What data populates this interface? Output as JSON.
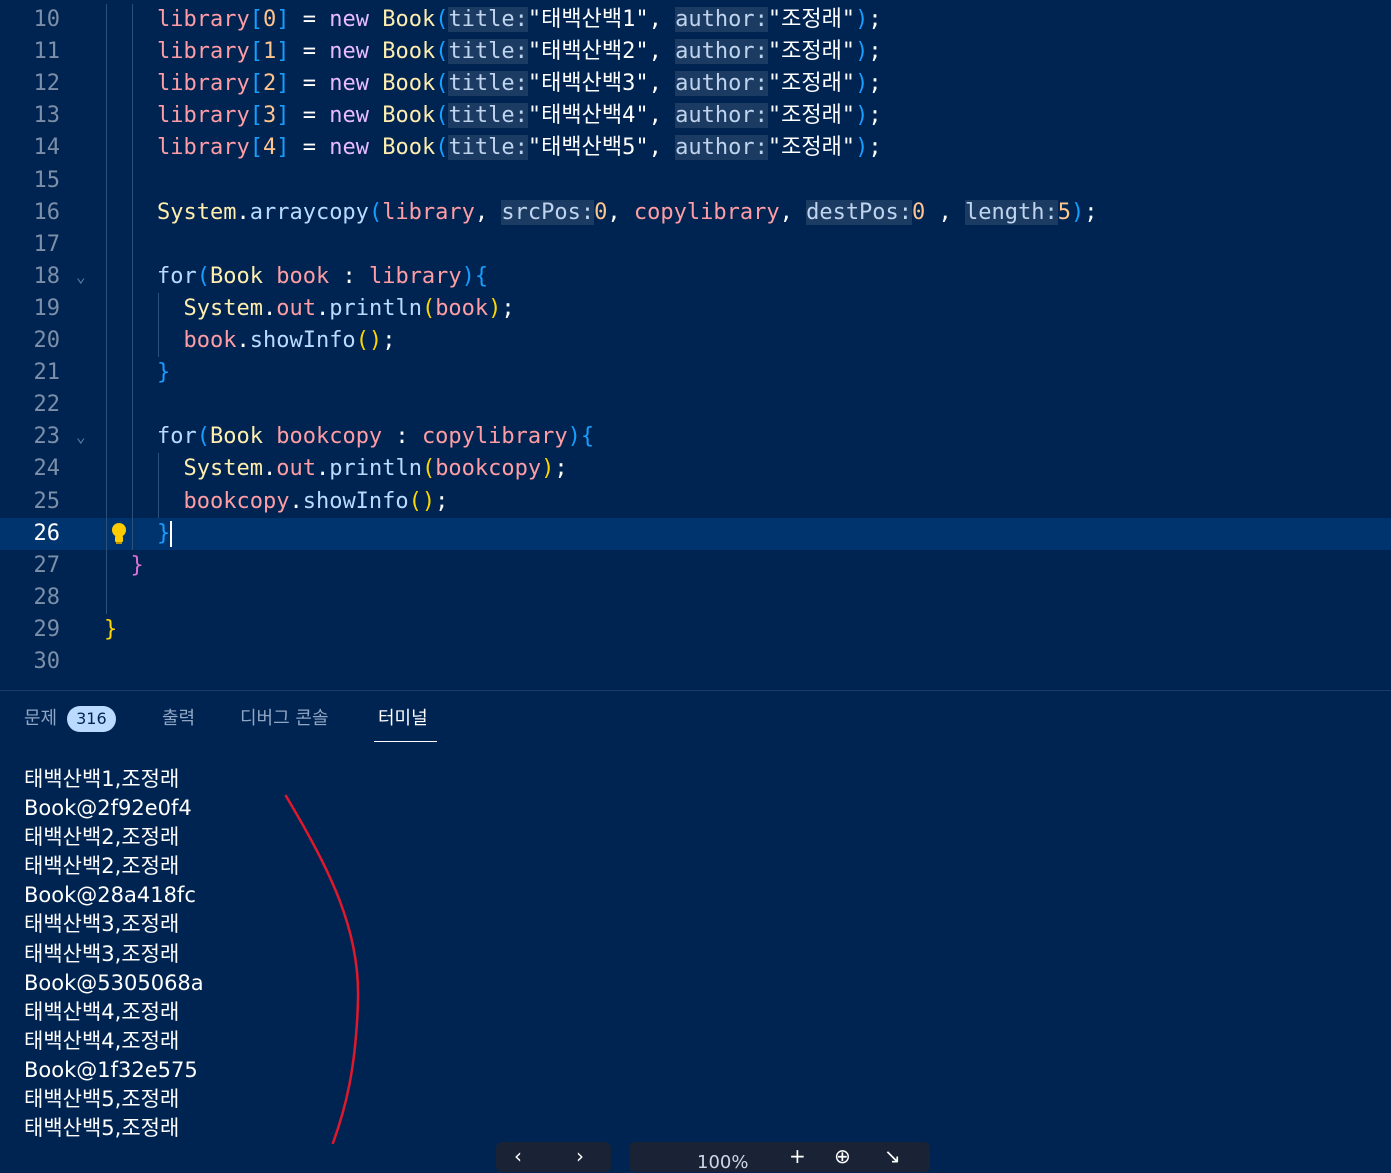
{
  "editor": {
    "lines": [
      {
        "n": "10",
        "fold": "",
        "tokens": [
          [
            "library",
            "var"
          ],
          [
            "[",
            "b3"
          ],
          [
            "0",
            "num"
          ],
          [
            "]",
            "b3"
          ],
          [
            " = ",
            "op"
          ],
          [
            "new",
            "kw"
          ],
          [
            " ",
            "op"
          ],
          [
            "Book",
            "cls"
          ],
          [
            "(",
            "b3"
          ],
          [
            "title:",
            "hint"
          ],
          [
            "\"태백산백1\"",
            "str"
          ],
          [
            ", ",
            "op"
          ],
          [
            "author:",
            "hint"
          ],
          [
            "\"조정래\"",
            "str"
          ],
          [
            ")",
            "b3"
          ],
          [
            ";",
            "op"
          ]
        ]
      },
      {
        "n": "11",
        "fold": "",
        "tokens": [
          [
            "library",
            "var"
          ],
          [
            "[",
            "b3"
          ],
          [
            "1",
            "num"
          ],
          [
            "]",
            "b3"
          ],
          [
            " = ",
            "op"
          ],
          [
            "new",
            "kw"
          ],
          [
            " ",
            "op"
          ],
          [
            "Book",
            "cls"
          ],
          [
            "(",
            "b3"
          ],
          [
            "title:",
            "hint"
          ],
          [
            "\"태백산백2\"",
            "str"
          ],
          [
            ", ",
            "op"
          ],
          [
            "author:",
            "hint"
          ],
          [
            "\"조정래\"",
            "str"
          ],
          [
            ")",
            "b3"
          ],
          [
            ";",
            "op"
          ]
        ]
      },
      {
        "n": "12",
        "fold": "",
        "tokens": [
          [
            "library",
            "var"
          ],
          [
            "[",
            "b3"
          ],
          [
            "2",
            "num"
          ],
          [
            "]",
            "b3"
          ],
          [
            " = ",
            "op"
          ],
          [
            "new",
            "kw"
          ],
          [
            " ",
            "op"
          ],
          [
            "Book",
            "cls"
          ],
          [
            "(",
            "b3"
          ],
          [
            "title:",
            "hint"
          ],
          [
            "\"태백산백3\"",
            "str"
          ],
          [
            ", ",
            "op"
          ],
          [
            "author:",
            "hint"
          ],
          [
            "\"조정래\"",
            "str"
          ],
          [
            ")",
            "b3"
          ],
          [
            ";",
            "op"
          ]
        ]
      },
      {
        "n": "13",
        "fold": "",
        "tokens": [
          [
            "library",
            "var"
          ],
          [
            "[",
            "b3"
          ],
          [
            "3",
            "num"
          ],
          [
            "]",
            "b3"
          ],
          [
            " = ",
            "op"
          ],
          [
            "new",
            "kw"
          ],
          [
            " ",
            "op"
          ],
          [
            "Book",
            "cls"
          ],
          [
            "(",
            "b3"
          ],
          [
            "title:",
            "hint"
          ],
          [
            "\"태백산백4\"",
            "str"
          ],
          [
            ", ",
            "op"
          ],
          [
            "author:",
            "hint"
          ],
          [
            "\"조정래\"",
            "str"
          ],
          [
            ")",
            "b3"
          ],
          [
            ";",
            "op"
          ]
        ]
      },
      {
        "n": "14",
        "fold": "",
        "tokens": [
          [
            "library",
            "var"
          ],
          [
            "[",
            "b3"
          ],
          [
            "4",
            "num"
          ],
          [
            "]",
            "b3"
          ],
          [
            " = ",
            "op"
          ],
          [
            "new",
            "kw"
          ],
          [
            " ",
            "op"
          ],
          [
            "Book",
            "cls"
          ],
          [
            "(",
            "b3"
          ],
          [
            "title:",
            "hint"
          ],
          [
            "\"태백산백5\"",
            "str"
          ],
          [
            ", ",
            "op"
          ],
          [
            "author:",
            "hint"
          ],
          [
            "\"조정래\"",
            "str"
          ],
          [
            ")",
            "b3"
          ],
          [
            ";",
            "op"
          ]
        ]
      },
      {
        "n": "15",
        "fold": "",
        "tokens": []
      },
      {
        "n": "16",
        "fold": "",
        "tokens": [
          [
            "System",
            "cls"
          ],
          [
            ".",
            "op"
          ],
          [
            "arraycopy",
            "fn"
          ],
          [
            "(",
            "b3"
          ],
          [
            "library",
            "var"
          ],
          [
            ", ",
            "op"
          ],
          [
            "srcPos:",
            "hint"
          ],
          [
            "0",
            "num"
          ],
          [
            ", ",
            "op"
          ],
          [
            "copylibrary",
            "var"
          ],
          [
            ", ",
            "op"
          ],
          [
            "destPos:",
            "hint"
          ],
          [
            "0",
            "num"
          ],
          [
            " , ",
            "op"
          ],
          [
            "length:",
            "hint"
          ],
          [
            "5",
            "num"
          ],
          [
            ")",
            "b3"
          ],
          [
            ";",
            "op"
          ]
        ]
      },
      {
        "n": "17",
        "fold": "",
        "tokens": []
      },
      {
        "n": "18",
        "fold": "⌄",
        "tokens": [
          [
            "for",
            "for"
          ],
          [
            "(",
            "b3"
          ],
          [
            "Book",
            "cls"
          ],
          [
            " ",
            "op"
          ],
          [
            "book",
            "var"
          ],
          [
            " : ",
            "op"
          ],
          [
            "library",
            "var"
          ],
          [
            ")",
            "b3"
          ],
          [
            "{",
            "b3"
          ]
        ]
      },
      {
        "n": "19",
        "fold": "",
        "tokens": [
          [
            "  ",
            "op"
          ],
          [
            "System",
            "cls"
          ],
          [
            ".",
            "op"
          ],
          [
            "out",
            "var"
          ],
          [
            ".",
            "op"
          ],
          [
            "println",
            "fn"
          ],
          [
            "(",
            "b1"
          ],
          [
            "book",
            "var"
          ],
          [
            ")",
            "b1"
          ],
          [
            ";",
            "op"
          ]
        ]
      },
      {
        "n": "20",
        "fold": "",
        "tokens": [
          [
            "  ",
            "op"
          ],
          [
            "book",
            "var"
          ],
          [
            ".",
            "op"
          ],
          [
            "showInfo",
            "fn"
          ],
          [
            "()",
            "b1"
          ],
          [
            ";",
            "op"
          ]
        ]
      },
      {
        "n": "21",
        "fold": "",
        "tokens": [
          [
            "}",
            "b3"
          ]
        ]
      },
      {
        "n": "22",
        "fold": "",
        "tokens": []
      },
      {
        "n": "23",
        "fold": "⌄",
        "tokens": [
          [
            "for",
            "for"
          ],
          [
            "(",
            "b3"
          ],
          [
            "Book",
            "cls"
          ],
          [
            " ",
            "op"
          ],
          [
            "bookcopy",
            "var"
          ],
          [
            " : ",
            "op"
          ],
          [
            "copylibrary",
            "var"
          ],
          [
            ")",
            "b3"
          ],
          [
            "{",
            "b3"
          ]
        ]
      },
      {
        "n": "24",
        "fold": "",
        "tokens": [
          [
            "  ",
            "op"
          ],
          [
            "System",
            "cls"
          ],
          [
            ".",
            "op"
          ],
          [
            "out",
            "var"
          ],
          [
            ".",
            "op"
          ],
          [
            "println",
            "fn"
          ],
          [
            "(",
            "b1"
          ],
          [
            "bookcopy",
            "var"
          ],
          [
            ")",
            "b1"
          ],
          [
            ";",
            "op"
          ]
        ]
      },
      {
        "n": "25",
        "fold": "",
        "tokens": [
          [
            "  ",
            "op"
          ],
          [
            "bookcopy",
            "var"
          ],
          [
            ".",
            "op"
          ],
          [
            "showInfo",
            "fn"
          ],
          [
            "()",
            "b1"
          ],
          [
            ";",
            "op"
          ]
        ]
      },
      {
        "n": "26",
        "fold": "",
        "tokens": [
          [
            "}",
            "b3"
          ]
        ],
        "active": true
      },
      {
        "n": "27",
        "fold": "",
        "tokens": [
          [
            "}",
            "b2"
          ]
        ]
      },
      {
        "n": "28",
        "fold": "",
        "tokens": []
      },
      {
        "n": "29",
        "fold": "",
        "tokens": [
          [
            "}",
            "b1"
          ]
        ]
      },
      {
        "n": "30",
        "fold": "",
        "tokens": []
      }
    ],
    "indent": [
      2,
      2,
      2,
      2,
      2,
      2,
      2,
      2,
      2,
      2,
      2,
      2,
      2,
      2,
      2,
      2,
      2,
      1,
      1,
      0,
      0
    ]
  },
  "panel": {
    "tabs": [
      {
        "label": "문제",
        "badge": "316",
        "active": false
      },
      {
        "label": "출력",
        "active": false
      },
      {
        "label": "디버그 콘솔",
        "active": false
      },
      {
        "label": "터미널",
        "active": true
      }
    ],
    "terminal": [
      "태백산백1,조정래",
      "Book@2f92e0f4",
      "태백산백2,조정래",
      "태백산백2,조정래",
      "Book@28a418fc",
      "태백산백3,조정래",
      "태백산백3,조정래",
      "Book@5305068a",
      "태백산백4,조정래",
      "태백산백4,조정래",
      "Book@1f32e575",
      "태백산백5,조정래",
      "태백산백5,조정래"
    ]
  },
  "viewer": {
    "zoom": "100%"
  },
  "colors": {
    "background": "#002451",
    "annotation": "#e0182b",
    "highlight": "#00346e"
  }
}
